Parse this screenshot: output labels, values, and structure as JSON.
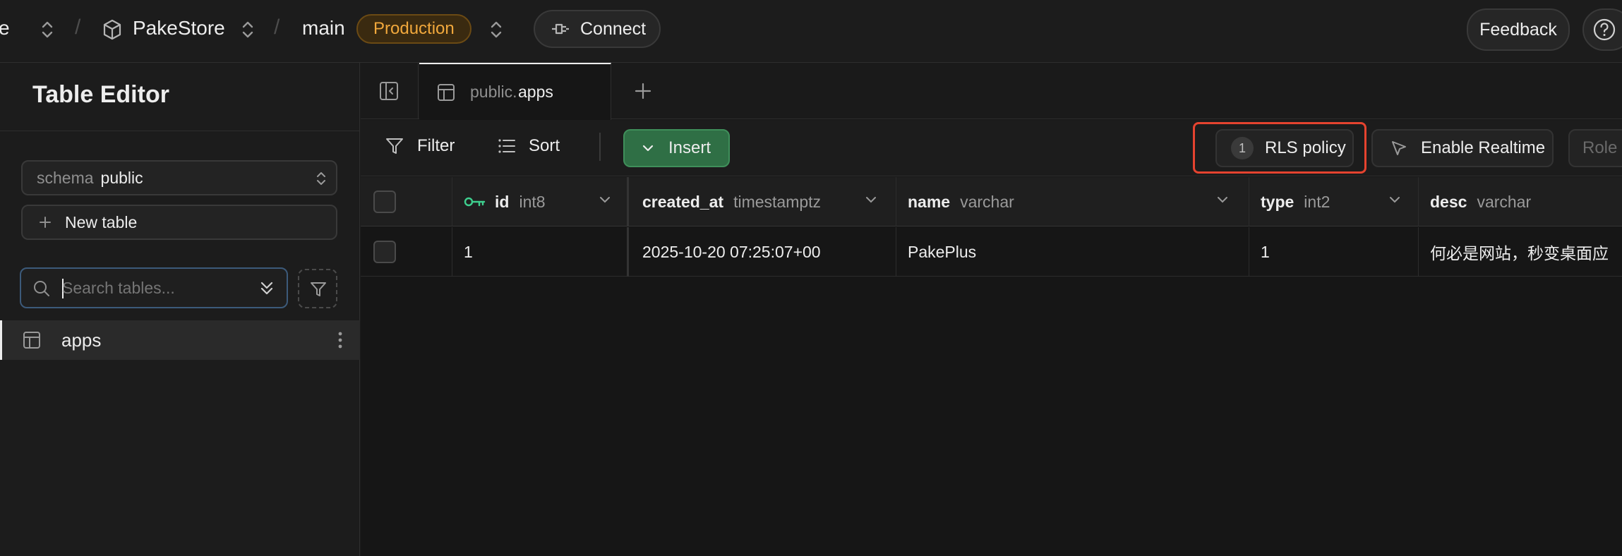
{
  "topbar": {
    "org_partial": "e",
    "project": "PakeStore",
    "branch": "main",
    "environment": "Production",
    "connect_label": "Connect",
    "feedback_label": "Feedback"
  },
  "sidebar": {
    "title": "Table Editor",
    "schema_prefix": "schema",
    "schema_value": "public",
    "new_table_label": "New table",
    "search_placeholder": "Search tables...",
    "tables": [
      {
        "name": "apps"
      }
    ]
  },
  "tabs": [
    {
      "schema": "public.",
      "table": "apps"
    }
  ],
  "toolbar": {
    "filter_label": "Filter",
    "sort_label": "Sort",
    "insert_label": "Insert",
    "rls_count": "1",
    "rls_label": "RLS policy",
    "realtime_label": "Enable Realtime",
    "role_label": "Role"
  },
  "grid": {
    "columns": [
      {
        "name": "id",
        "type": "int8",
        "primary_key": true
      },
      {
        "name": "created_at",
        "type": "timestamptz"
      },
      {
        "name": "name",
        "type": "varchar"
      },
      {
        "name": "type",
        "type": "int2"
      },
      {
        "name": "desc",
        "type": "varchar"
      }
    ],
    "rows": [
      {
        "id": "1",
        "created_at": "2025-10-20 07:25:07+00",
        "name": "PakePlus",
        "type": "1",
        "desc": "何必是网站，秒变桌面应"
      }
    ]
  },
  "colors": {
    "accent_green": "#3ecf8e",
    "insert_bg": "#2f6f45",
    "production_text": "#f1a83c",
    "highlight_box": "#e5432f"
  }
}
